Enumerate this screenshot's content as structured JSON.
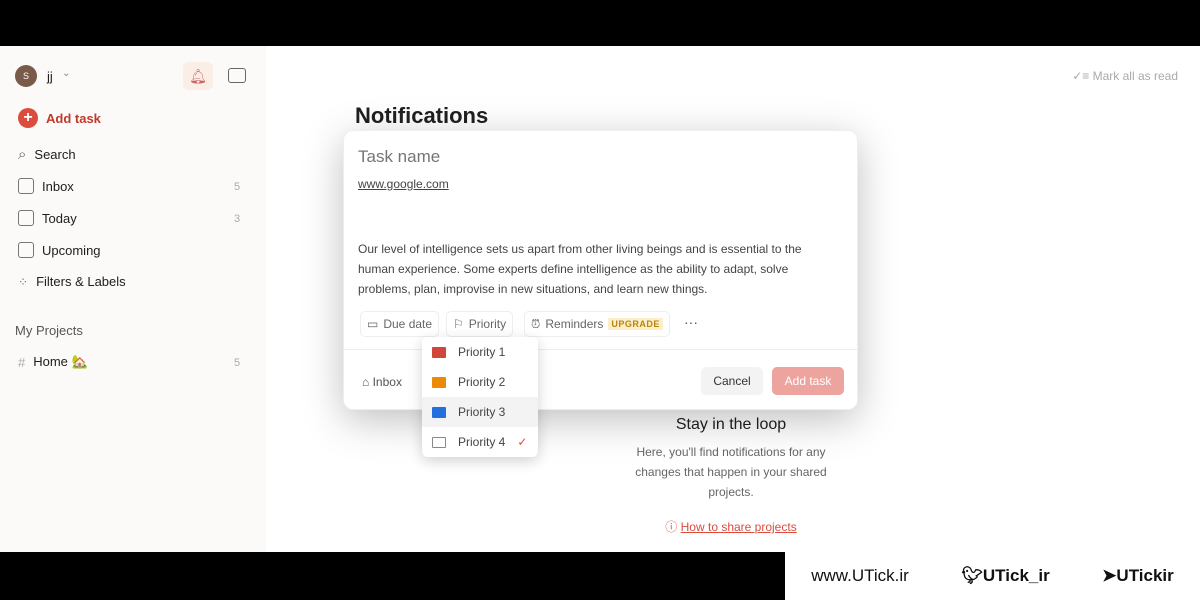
{
  "sidebar": {
    "avatar_letter": "S",
    "user": "jj",
    "add_task": "Add task",
    "items": [
      {
        "label": "Search",
        "count": ""
      },
      {
        "label": "Inbox",
        "count": "5"
      },
      {
        "label": "Today",
        "count": "3"
      },
      {
        "label": "Upcoming",
        "count": ""
      },
      {
        "label": "Filters & Labels",
        "count": ""
      }
    ],
    "projects_heading": "My Projects",
    "projects": [
      {
        "label": "Home 🏡",
        "count": "5"
      }
    ]
  },
  "header": {
    "mark_all_read": "Mark all as read",
    "page_title": "Notifications"
  },
  "modal": {
    "task_name_placeholder": "Task name",
    "link": "www.google.com",
    "description": "Our level of intelligence sets us apart from other living beings and is essential to the human experience. Some experts define intelligence as the ability to adapt, solve problems, plan, improvise in new situations, and learn new things.",
    "due_date": "Due date",
    "priority": "Priority",
    "reminders": "Reminders",
    "upgrade_badge": "UPGRADE",
    "more": "···",
    "project": "Inbox",
    "cancel": "Cancel",
    "add_task": "Add task"
  },
  "priority_menu": [
    {
      "label": "Priority 1",
      "color": "#d1453b"
    },
    {
      "label": "Priority 2",
      "color": "#eb8909"
    },
    {
      "label": "Priority 3",
      "color": "#246fe0"
    },
    {
      "label": "Priority 4",
      "color": "#ffffff",
      "selected": "✓"
    }
  ],
  "empty_state": {
    "title": "Stay in the loop",
    "body": "Here, you'll find notifications for any changes that happen in your shared projects.",
    "link": "How to share projects"
  },
  "watermark": {
    "site": "www.UTick.ir",
    "twitter": "UTick_ir",
    "telegram": "UTickir"
  },
  "colors": {
    "accent": "#dc4c3e"
  }
}
